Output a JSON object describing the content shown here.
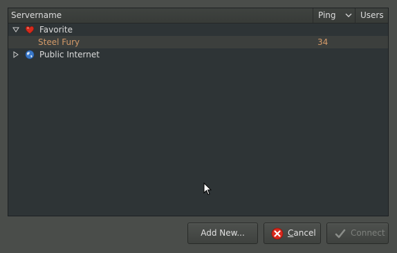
{
  "tree": {
    "columns": {
      "servername": "Servername",
      "ping": "Ping",
      "users": "Users"
    },
    "groups": [
      {
        "label": "Favorite",
        "icon": "heart-icon",
        "expanded": true,
        "children": [
          {
            "label": "Steel Fury",
            "ping": "34",
            "users": ""
          }
        ]
      },
      {
        "label": "Public Internet",
        "icon": "globe-icon",
        "expanded": false
      }
    ]
  },
  "buttons": {
    "add_new": "Add New...",
    "cancel": "Cancel",
    "connect": "Connect"
  },
  "colors": {
    "background": "#4a4d4a",
    "list_background": "#2e3436",
    "server_text": "#d49a69",
    "disabled_text": "#7d807c"
  }
}
